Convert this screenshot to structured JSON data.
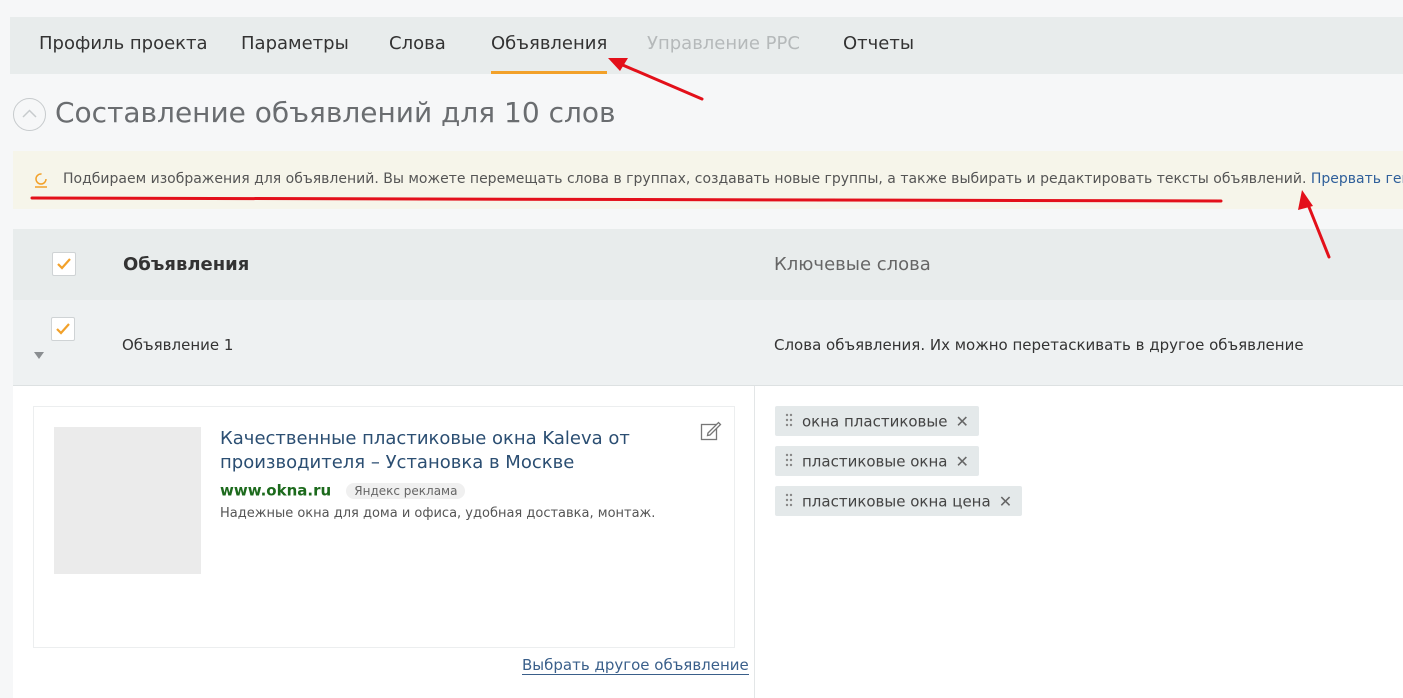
{
  "tabs": [
    {
      "label": "Профиль проекта"
    },
    {
      "label": "Параметры"
    },
    {
      "label": "Слова"
    },
    {
      "label": "Объявления"
    },
    {
      "label": "Управление PPC"
    },
    {
      "label": "Отчеты"
    }
  ],
  "active_tab": "Объявления",
  "disabled_tab": "Управление PPC",
  "page_title": "Составление объявлений для 10 слов",
  "notice": {
    "text": "Подбираем изображения для объявлений. Вы можете перемещать слова в группах, создавать новые группы, а также выбирать и редактировать тексты объявлений.",
    "link": "Прервать генерацию",
    "icon": "spinner-icon"
  },
  "table": {
    "header_ads": "Объявления",
    "header_keywords": "Ключевые слова",
    "header_checked": true
  },
  "row": {
    "name": "Объявление 1",
    "words_hint": "Слова объявления. Их можно перетаскивать в другое объявление",
    "checked": true
  },
  "ad": {
    "title": "Качественные пластиковые окна Kaleva от производителя – Установка в Москве",
    "domain": "www.okna.ru",
    "badge": "Яндекс реклама",
    "description": "Надежные окна для дома и офиса, удобная доставка, монтаж.",
    "choose_other": "Выбрать другое объявление"
  },
  "keywords": [
    {
      "text": "окна пластиковые"
    },
    {
      "text": "пластиковые окна"
    },
    {
      "text": "пластиковые окна цена"
    }
  ],
  "colors": {
    "accent_underline": "#f2a12a",
    "annotation_red": "#e3101a",
    "link_blue": "#2f5f9a",
    "domain_green": "#1c6a1c",
    "check_orange": "#f2a12a"
  }
}
